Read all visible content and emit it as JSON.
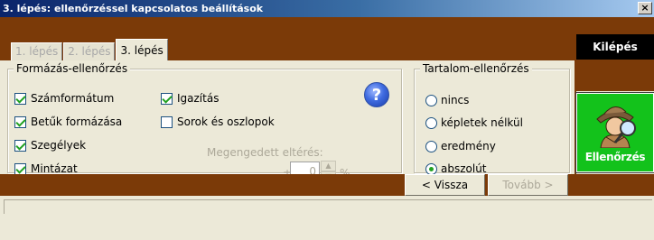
{
  "window": {
    "title": "3. lépés: ellenőrzéssel kapcsolatos beállítások",
    "close_label": "×"
  },
  "tabs": [
    {
      "label": "1. lépés",
      "active": false
    },
    {
      "label": "2. lépés",
      "active": false
    },
    {
      "label": "3. lépés",
      "active": true
    }
  ],
  "exit_button": {
    "label": "Kilépés"
  },
  "format_check": {
    "legend": "Formázás-ellenőrzés",
    "options": [
      {
        "label": "Számformátum",
        "checked": true
      },
      {
        "label": "Igazítás",
        "checked": true
      },
      {
        "label": "Betűk formázása",
        "checked": true
      },
      {
        "label": "Sorok és oszlopok",
        "checked": false
      },
      {
        "label": "Szegélyek",
        "checked": true
      },
      {
        "label": "Mintázat",
        "checked": true
      }
    ],
    "tolerance": {
      "label": "Megengedett eltérés:",
      "prefix": "±",
      "value": "0",
      "unit": "%"
    }
  },
  "content_check": {
    "legend": "Tartalom-ellenőrzés",
    "options": [
      {
        "label": "nincs",
        "selected": false
      },
      {
        "label": "képletek nélkül",
        "selected": false
      },
      {
        "label": "eredmény",
        "selected": false
      },
      {
        "label": "abszolút",
        "selected": true
      }
    ]
  },
  "check_button": {
    "label": "Ellenőrzés"
  },
  "nav": {
    "back_label": "< Vissza",
    "next_label": "Tovább >"
  },
  "colors": {
    "brown": "#7b3a08",
    "green": "#13c21b",
    "panel": "#ece9d8"
  },
  "icons": {
    "help": "help-icon",
    "detective": "detective-icon"
  }
}
